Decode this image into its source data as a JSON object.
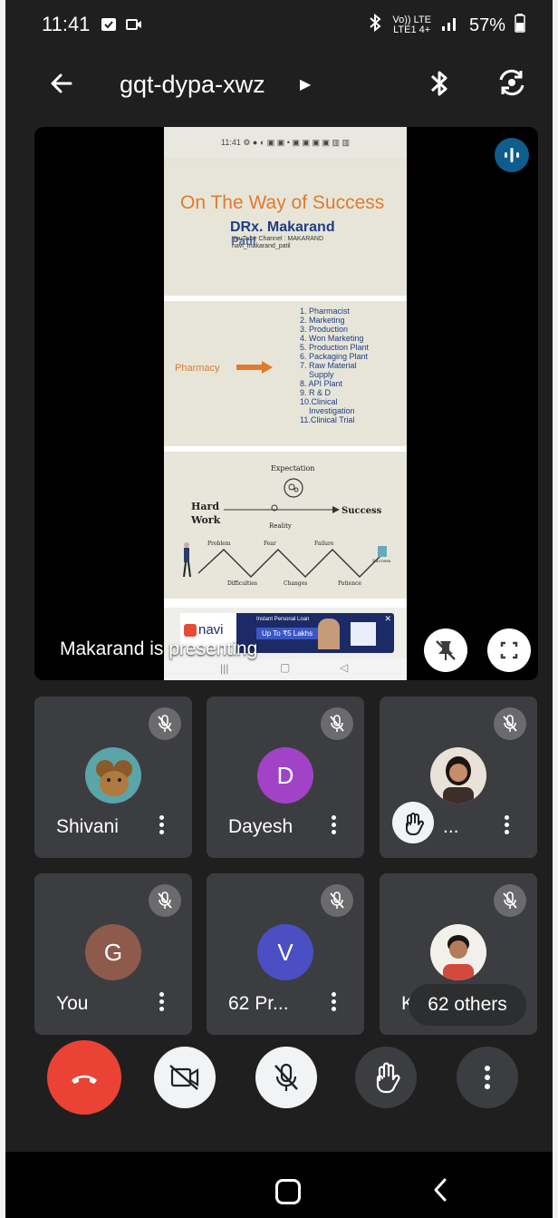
{
  "status_bar": {
    "time": "11:41",
    "network_label_top": "Vo)) LTE",
    "network_label_bottom": "LTE1 4+",
    "battery": "57%"
  },
  "header": {
    "meeting_code": "gqt-dypa-xwz",
    "back_icon": "arrow-left-icon",
    "bluetooth_icon": "bluetooth-icon",
    "camera_switch_icon": "camera-switch-icon"
  },
  "stage": {
    "presenting_label": "Makarand is presenting",
    "slide": {
      "status_text": "11:41 ⚙ ● ◐ ▣ ▣ • ▣ ▣ ▣ ▣ ▥ ▥",
      "title": "On The Way of Success",
      "author": "DRx. Makarand",
      "author_overlap": "Patil",
      "sub_line1": "YouTube Channel : MAKARAND",
      "sub_line2": "navi_makarand_patil",
      "pharmacy_label": "Pharmacy",
      "careers": [
        "1. Pharmacist",
        "2. Marketing",
        "3. Production",
        "4. Won Marketing",
        "5. Production Plant",
        "6. Packaging Plant",
        "7. Raw Material",
        "    Supply",
        "8. API Plant",
        "9. R & D",
        "10.Clinical",
        "    Investigation",
        "11.Clinical Trial"
      ],
      "expectation": "Expectation",
      "hard_work_1": "Hard",
      "hard_work_2": "Work",
      "reality": "Reality",
      "success": "Success",
      "zigzag_top": [
        "Problem",
        "Fear",
        "Failure"
      ],
      "zigzag_bottom": [
        "Difficulties",
        "Changes",
        "Patience"
      ],
      "zigzag_end": "Success",
      "ad_brand": "navi",
      "ad_line1": "Instant Personal Loan",
      "ad_line2": "Up To ₹5 Lakhs"
    }
  },
  "participants": [
    {
      "name": "Shivani",
      "avatar_type": "image",
      "avatar_color": "#5ba4a8"
    },
    {
      "name": "Dayesh",
      "avatar_letter": "D",
      "avatar_color": "#a142c7"
    },
    {
      "name": "...",
      "avatar_type": "image",
      "avatar_color": "#8a5a44",
      "hand_raised": true
    },
    {
      "name": "You",
      "avatar_letter": "G",
      "avatar_color": "#8d5a4c"
    },
    {
      "name": "62 Pr...",
      "avatar_letter": "V",
      "avatar_color": "#4b4fc4"
    },
    {
      "name": "Ka...",
      "avatar_type": "image",
      "avatar_color": "#b08060",
      "others_label": "62 others"
    }
  ],
  "controls": {
    "end_call_icon": "phone-hangup-icon",
    "camera_icon": "camera-off-icon",
    "mic_icon": "mic-off-icon",
    "hand_icon": "raise-hand-icon",
    "more_icon": "more-vertical-icon"
  },
  "colors": {
    "end_call": "#ea4335",
    "background": "#1f1f1f",
    "tile": "#3c3d40"
  }
}
